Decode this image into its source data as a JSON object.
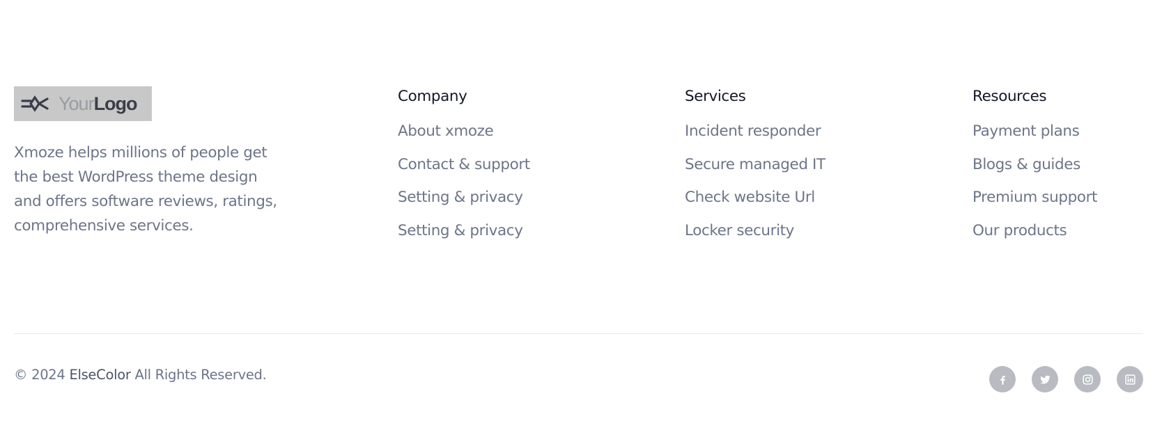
{
  "brand": {
    "logo_your": "Your",
    "logo_logo": "Logo",
    "description": "Xmoze helps millions of people get the best WordPress theme design and offers software reviews, ratings, comprehensive services."
  },
  "columns": [
    {
      "title": "Company",
      "links": [
        "About xmoze",
        "Contact & support",
        "Setting & privacy",
        "Setting & privacy"
      ]
    },
    {
      "title": "Services",
      "links": [
        "Incident responder",
        "Secure managed IT",
        "Check website Url",
        "Locker security"
      ]
    },
    {
      "title": "Resources",
      "links": [
        "Payment plans",
        "Blogs & guides",
        "Premium support",
        "Our products"
      ]
    }
  ],
  "footer": {
    "copyright_prefix": "© 2024",
    "company": "ElseColor",
    "copyright_suffix": "All Rights Reserved."
  },
  "social": [
    {
      "icon": "facebook-icon"
    },
    {
      "icon": "twitter-icon"
    },
    {
      "icon": "instagram-icon"
    },
    {
      "icon": "linkedin-icon"
    }
  ],
  "colors": {
    "heading": "#141827",
    "text": "#6c7589",
    "social_bg": "#b8bbc1",
    "logo_bg": "#c8c8c8"
  }
}
